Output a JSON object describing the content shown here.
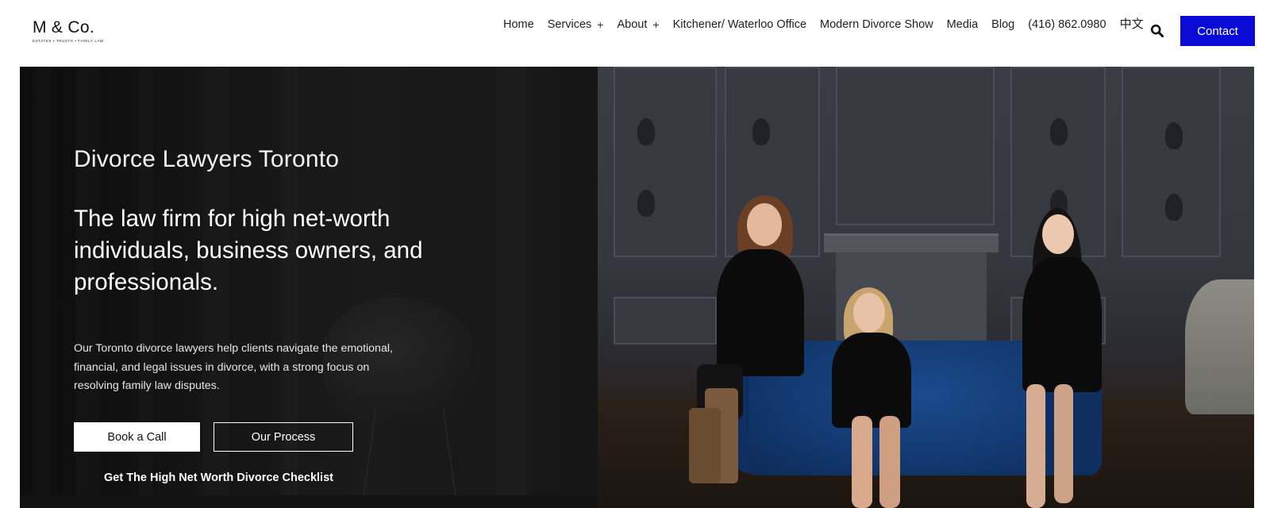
{
  "header": {
    "logo": {
      "mark": "M & Co.",
      "tagline": "ESTATES • TRUSTS • FAMILY LAW"
    },
    "nav": [
      {
        "label": "Home",
        "has_submenu": false
      },
      {
        "label": "Services",
        "has_submenu": true
      },
      {
        "label": "About",
        "has_submenu": true
      },
      {
        "label": "Kitchener/ Waterloo Office",
        "has_submenu": false
      },
      {
        "label": "Modern Divorce Show",
        "has_submenu": false
      },
      {
        "label": "Media",
        "has_submenu": false
      },
      {
        "label": "Blog",
        "has_submenu": false
      },
      {
        "label": "(416) 862.0980",
        "has_submenu": false
      },
      {
        "label": "中文",
        "has_submenu": false
      }
    ],
    "submenu_indicator": "+",
    "search_icon": "search-icon",
    "contact_label": "Contact",
    "contact_color": "#0a0ad6"
  },
  "hero": {
    "title": "Divorce Lawyers Toronto",
    "headline": "The law firm for high net-worth individuals, business owners, and professionals.",
    "body": "Our Toronto divorce lawyers help clients navigate the emotional, financial, and legal issues in divorce, with a strong focus on resolving family law disputes.",
    "primary_button": "Book a Call",
    "secondary_button": "Our Process",
    "checklist_link": "Get The High Net Worth Divorce Checklist"
  }
}
